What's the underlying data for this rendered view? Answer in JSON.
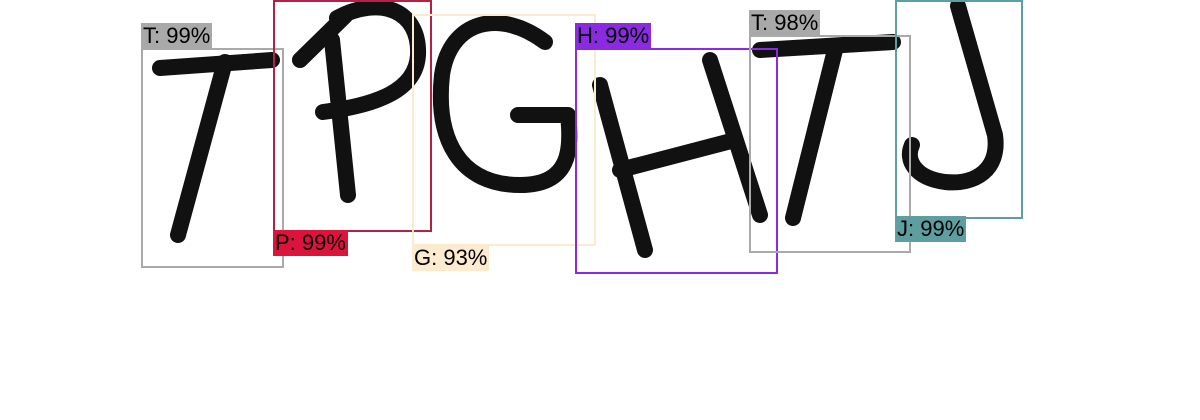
{
  "detections": [
    {
      "id": "t1",
      "letter": "T",
      "label": "T: 99%",
      "confidence": 0.99,
      "color": "#a9a9a9"
    },
    {
      "id": "p",
      "letter": "P",
      "label": "P: 99%",
      "confidence": 0.99,
      "color": "#dc143c"
    },
    {
      "id": "g",
      "letter": "G",
      "label": "G: 93%",
      "confidence": 0.93,
      "color": "#fdebd0"
    },
    {
      "id": "h",
      "letter": "H",
      "label": "H: 99%",
      "confidence": 0.99,
      "color": "#8a2be2"
    },
    {
      "id": "t2",
      "letter": "T",
      "label": "T: 98%",
      "confidence": 0.98,
      "color": "#a9a9a9"
    },
    {
      "id": "j",
      "letter": "J",
      "label": "J: 99%",
      "confidence": 0.99,
      "color": "#5f9ea0"
    }
  ]
}
